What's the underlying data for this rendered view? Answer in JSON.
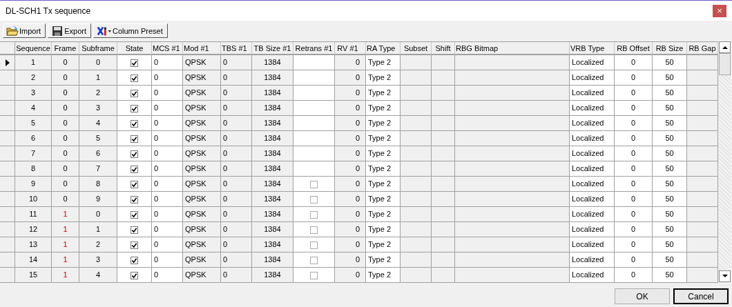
{
  "window": {
    "title": "DL-SCH1 Tx sequence",
    "close": "×"
  },
  "toolbar": [
    {
      "kind": "import",
      "label": "Import"
    },
    {
      "kind": "export",
      "label": "Export"
    },
    {
      "kind": "preset",
      "label": "Column Preset"
    }
  ],
  "columns": [
    "Sequence",
    "Frame",
    "Subframe",
    "State",
    "MCS #1",
    "Mod #1",
    "TBS #1",
    "TB Size #1",
    "Retrans #1",
    "RV #1",
    "RA Type",
    "Subset",
    "Shift",
    "RBG Bitmap",
    "VRB Type",
    "RB Offset",
    "RB Size",
    "RB Gap"
  ],
  "rows": [
    {
      "selected": true,
      "cells": [
        "1",
        {
          "text": "0",
          "highlighted": false
        },
        "0",
        {
          "checked": true
        },
        "0",
        "QPSK",
        "0",
        "1384",
        null,
        "0",
        "Type 2",
        null,
        null,
        null,
        "Localized",
        "0",
        "50",
        null
      ]
    },
    {
      "selected": false,
      "cells": [
        "2",
        {
          "text": "0",
          "highlighted": false
        },
        "1",
        {
          "checked": true
        },
        "0",
        "QPSK",
        "0",
        "1384",
        null,
        "0",
        "Type 2",
        null,
        null,
        null,
        "Localized",
        "0",
        "50",
        null
      ]
    },
    {
      "selected": false,
      "cells": [
        "3",
        {
          "text": "0",
          "highlighted": false
        },
        "2",
        {
          "checked": true
        },
        "0",
        "QPSK",
        "0",
        "1384",
        null,
        "0",
        "Type 2",
        null,
        null,
        null,
        "Localized",
        "0",
        "50",
        null
      ]
    },
    {
      "selected": false,
      "cells": [
        "4",
        {
          "text": "0",
          "highlighted": false
        },
        "3",
        {
          "checked": true
        },
        "0",
        "QPSK",
        "0",
        "1384",
        null,
        "0",
        "Type 2",
        null,
        null,
        null,
        "Localized",
        "0",
        "50",
        null
      ]
    },
    {
      "selected": false,
      "cells": [
        "5",
        {
          "text": "0",
          "highlighted": false
        },
        "4",
        {
          "checked": true
        },
        "0",
        "QPSK",
        "0",
        "1384",
        null,
        "0",
        "Type 2",
        null,
        null,
        null,
        "Localized",
        "0",
        "50",
        null
      ]
    },
    {
      "selected": false,
      "cells": [
        "6",
        {
          "text": "0",
          "highlighted": false
        },
        "5",
        {
          "checked": true
        },
        "0",
        "QPSK",
        "0",
        "1384",
        null,
        "0",
        "Type 2",
        null,
        null,
        null,
        "Localized",
        "0",
        "50",
        null
      ]
    },
    {
      "selected": false,
      "cells": [
        "7",
        {
          "text": "0",
          "highlighted": false
        },
        "6",
        {
          "checked": true
        },
        "0",
        "QPSK",
        "0",
        "1384",
        null,
        "0",
        "Type 2",
        null,
        null,
        null,
        "Localized",
        "0",
        "50",
        null
      ]
    },
    {
      "selected": false,
      "cells": [
        "8",
        {
          "text": "0",
          "highlighted": false
        },
        "7",
        {
          "checked": true
        },
        "0",
        "QPSK",
        "0",
        "1384",
        null,
        "0",
        "Type 2",
        null,
        null,
        null,
        "Localized",
        "0",
        "50",
        null
      ]
    },
    {
      "selected": false,
      "cells": [
        "9",
        {
          "text": "0",
          "highlighted": false
        },
        "8",
        {
          "checked": true
        },
        "0",
        "QPSK",
        "0",
        "1384",
        {
          "checked": false
        },
        "0",
        "Type 2",
        null,
        null,
        null,
        "Localized",
        "0",
        "50",
        null
      ]
    },
    {
      "selected": false,
      "cells": [
        "10",
        {
          "text": "0",
          "highlighted": false
        },
        "9",
        {
          "checked": true
        },
        "0",
        "QPSK",
        "0",
        "1384",
        {
          "checked": false
        },
        "0",
        "Type 2",
        null,
        null,
        null,
        "Localized",
        "0",
        "50",
        null
      ]
    },
    {
      "selected": false,
      "cells": [
        "11",
        {
          "text": "1",
          "highlighted": true
        },
        "0",
        {
          "checked": true
        },
        "0",
        "QPSK",
        "0",
        "1384",
        {
          "checked": false
        },
        "0",
        "Type 2",
        null,
        null,
        null,
        "Localized",
        "0",
        "50",
        null
      ]
    },
    {
      "selected": false,
      "cells": [
        "12",
        {
          "text": "1",
          "highlighted": true
        },
        "1",
        {
          "checked": true
        },
        "0",
        "QPSK",
        "0",
        "1384",
        {
          "checked": false
        },
        "0",
        "Type 2",
        null,
        null,
        null,
        "Localized",
        "0",
        "50",
        null
      ]
    },
    {
      "selected": false,
      "cells": [
        "13",
        {
          "text": "1",
          "highlighted": true
        },
        "2",
        {
          "checked": true
        },
        "0",
        "QPSK",
        "0",
        "1384",
        {
          "checked": false
        },
        "0",
        "Type 2",
        null,
        null,
        null,
        "Localized",
        "0",
        "50",
        null
      ]
    },
    {
      "selected": false,
      "cells": [
        "14",
        {
          "text": "1",
          "highlighted": true
        },
        "3",
        {
          "checked": true
        },
        "0",
        "QPSK",
        "0",
        "1384",
        {
          "checked": false
        },
        "0",
        "Type 2",
        null,
        null,
        null,
        "Localized",
        "0",
        "50",
        null
      ]
    },
    {
      "selected": false,
      "cells": [
        "15",
        {
          "text": "1",
          "highlighted": true
        },
        "4",
        {
          "checked": true
        },
        "0",
        "QPSK",
        "0",
        "1384",
        {
          "checked": false
        },
        "0",
        "Type 2",
        null,
        null,
        null,
        "Localized",
        "0",
        "50",
        null
      ]
    }
  ],
  "buttons": [
    {
      "label": "OK",
      "default": false
    },
    {
      "label": "Cancel",
      "default": true
    }
  ]
}
